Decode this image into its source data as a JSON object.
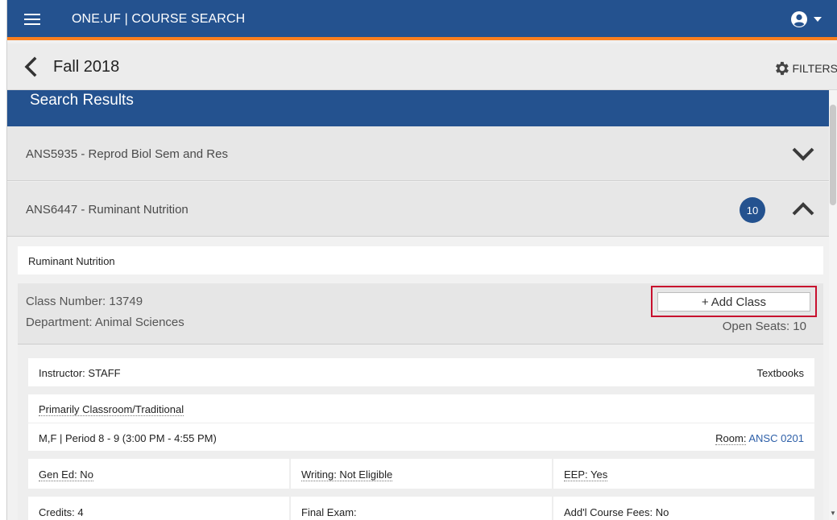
{
  "header": {
    "title": "ONE.UF | COURSE SEARCH"
  },
  "subheader": {
    "term": "Fall 2018",
    "filters_label": "FILTERS"
  },
  "results": {
    "heading": "Search Results"
  },
  "courses": [
    {
      "label": "ANS5935 - Reprod Biol Sem and Res",
      "expanded": false
    },
    {
      "label": "ANS6447 - Ruminant Nutrition",
      "expanded": true,
      "count": "10"
    }
  ],
  "detail": {
    "course_title": "Ruminant Nutrition",
    "class_number": "Class Number: 13749",
    "department": "Department: Animal Sciences",
    "add_class_label": "Add Class",
    "add_class_icon": "+",
    "open_seats": "Open Seats: 10",
    "instructor": "Instructor: STAFF",
    "textbooks_label": "Textbooks",
    "delivery": "Primarily Classroom/Traditional",
    "schedule": "M,F | Period 8 - 9 (3:00 PM - 4:55 PM)",
    "room_label": "Room:",
    "room_value": "ANSC 0201",
    "gen_ed": "Gen Ed: No",
    "writing": "Writing: Not Eligible",
    "eep": "EEP: Yes",
    "credits": "Credits: 4",
    "final_exam": "Final Exam:",
    "course_fees": "Add'l Course Fees: No"
  },
  "colors": {
    "brand_blue": "#24528f",
    "accent_orange": "#fa7f1e",
    "highlight_red": "#c8102e",
    "link_blue": "#2d5fa8"
  }
}
